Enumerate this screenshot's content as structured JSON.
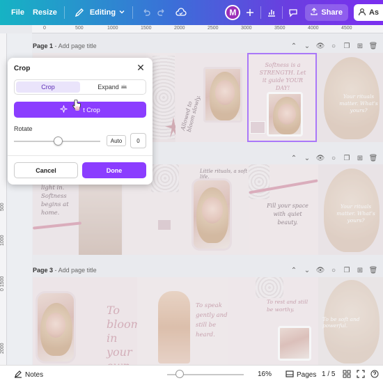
{
  "toolbar": {
    "file_label": "File",
    "resize_label": "Resize",
    "editing_label": "Editing",
    "avatar_initial": "M",
    "share_label": "Share",
    "ask_label": "As"
  },
  "rulers": {
    "top_ticks": [
      "0",
      "500",
      "1000",
      "1500",
      "2000",
      "2500",
      "3000",
      "3500",
      "4000",
      "4500"
    ],
    "left_ticks": [
      "500",
      "1000",
      "0 1500",
      "2000"
    ]
  },
  "pages": [
    {
      "number_label": "Page 1",
      "add_title": "Add page title"
    },
    {
      "number_label": "Page 3",
      "add_title": "Add page title"
    }
  ],
  "canvas_text": {
    "p1_softness": "Softness is a STRENGTH. Let it guide YOUR DAY!",
    "p1_allowed": "Allowed to bloom slowly.",
    "p1_your_rituals": "Your rituals matter. What's yours?",
    "p2_softness": "light in. Softness begins at home.",
    "p2_fill": "Fill your space with quiet beauty.",
    "p2_little": "Little rituals, a soft life.",
    "p2_your_rituals": "Your rituals matter. What's yours?",
    "p3_bloom": "To bloom in your own time...",
    "p3_speak": "To speak gently and still be heard.",
    "p3_rest": "To rest and still be worthy.",
    "p3_soft": "To be soft and powerful."
  },
  "crop_panel": {
    "title": "Crop",
    "tab_crop": "Crop",
    "tab_expand": "Expand",
    "smart_crop_label": "t Crop",
    "rotate_label": "Rotate",
    "rotate_slider_value": 0.5,
    "auto_label": "Auto",
    "rotate_value": "0",
    "cancel_label": "Cancel",
    "done_label": "Done"
  },
  "bottombar": {
    "notes_label": "Notes",
    "zoom_label": "16%",
    "zoom_value": 0.16,
    "pages_label": "Pages",
    "page_count": "1 / 5"
  },
  "colors": {
    "accent": "#8b3dff",
    "topbar_start": "#16b3c4",
    "topbar_end": "#7b2ff0"
  }
}
